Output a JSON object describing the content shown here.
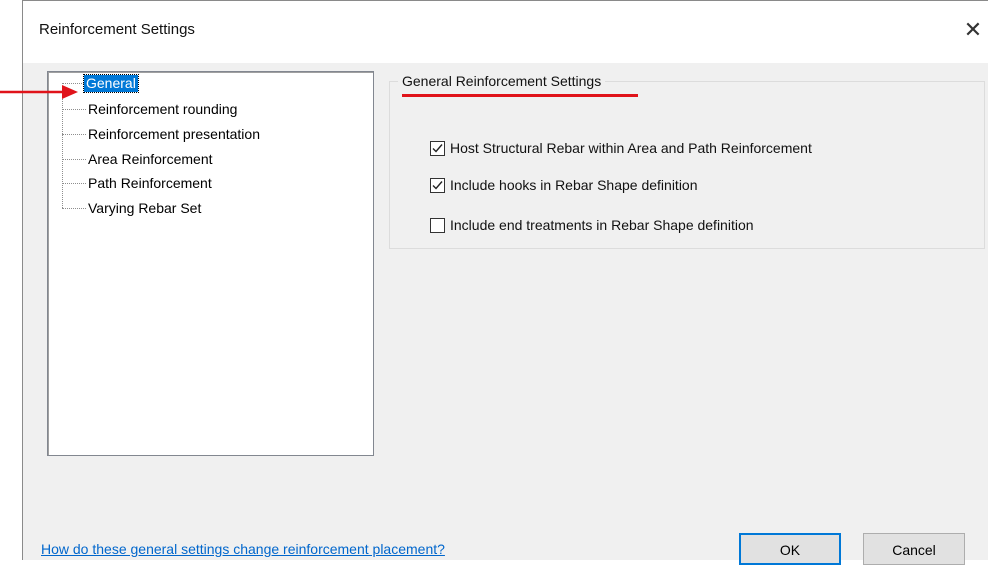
{
  "window": {
    "title": "Reinforcement Settings",
    "close_glyph": "✕"
  },
  "tree": {
    "selected": "General",
    "items": [
      {
        "label": "Reinforcement rounding"
      },
      {
        "label": "Reinforcement presentation"
      },
      {
        "label": "Area Reinforcement"
      },
      {
        "label": "Path Reinforcement"
      },
      {
        "label": "Varying Rebar Set"
      }
    ]
  },
  "group": {
    "title": "General Reinforcement Settings",
    "options": [
      {
        "label": "Host Structural Rebar within Area and Path Reinforcement",
        "checked": true
      },
      {
        "label": "Include hooks in Rebar Shape definition",
        "checked": true
      },
      {
        "label": "Include end treatments in Rebar Shape definition",
        "checked": false
      }
    ]
  },
  "footer": {
    "help_link": "How do these general settings change reinforcement placement?",
    "ok_label": "OK",
    "cancel_label": "Cancel"
  },
  "colors": {
    "annotation": "#e0131a",
    "selection": "#0078d7",
    "link": "#0066cc"
  }
}
